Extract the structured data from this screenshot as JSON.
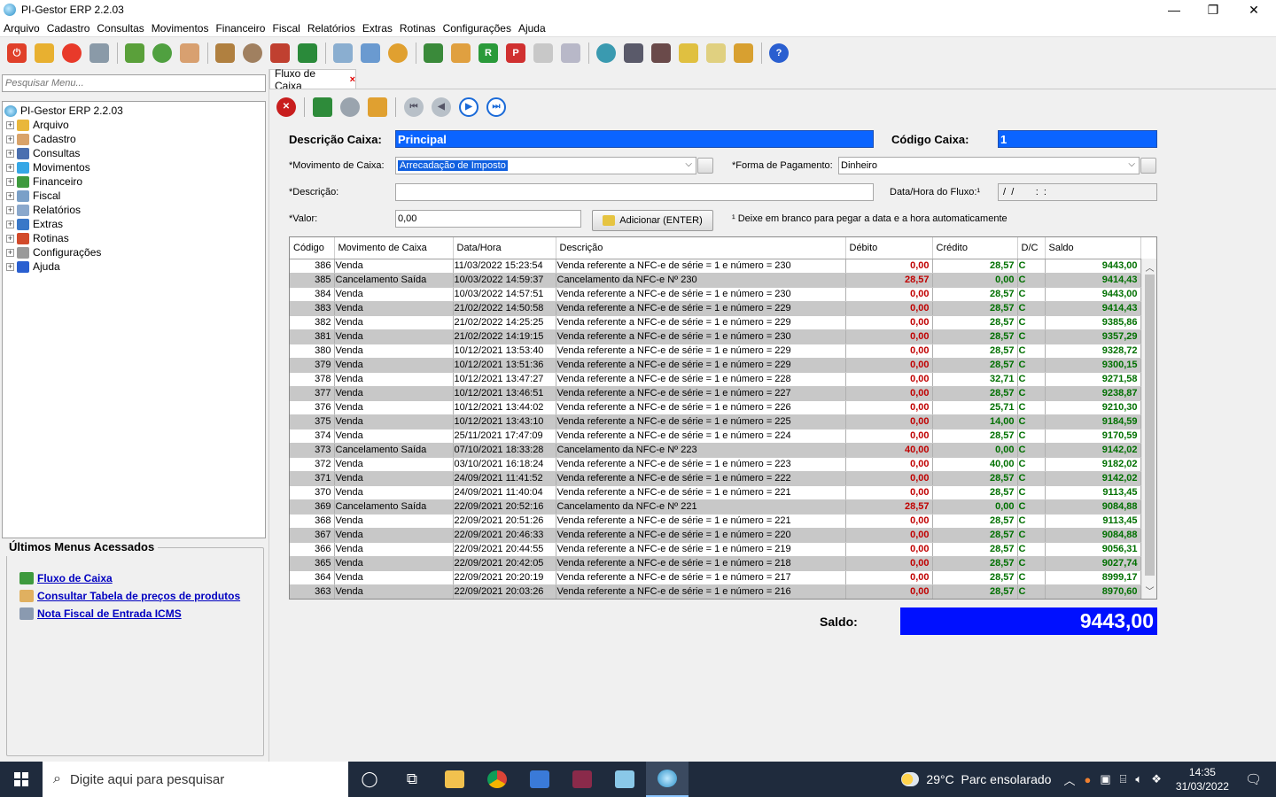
{
  "window": {
    "title": "PI-Gestor ERP 2.2.03",
    "minimize": "—",
    "maximize": "❐",
    "close": "✕"
  },
  "menubar": [
    "Arquivo",
    "Cadastro",
    "Consultas",
    "Movimentos",
    "Financeiro",
    "Fiscal",
    "Relatórios",
    "Extras",
    "Rotinas",
    "Configurações",
    "Ajuda"
  ],
  "left": {
    "search_placeholder": "Pesquisar Menu...",
    "tree_root": "PI-Gestor ERP 2.2.03",
    "tree_items": [
      {
        "label": "Arquivo",
        "color": "#e9b73b"
      },
      {
        "label": "Cadastro",
        "color": "#d9a36a"
      },
      {
        "label": "Consultas",
        "color": "#4a6fb0"
      },
      {
        "label": "Movimentos",
        "color": "#35a7e6"
      },
      {
        "label": "Financeiro",
        "color": "#3e9a3e"
      },
      {
        "label": "Fiscal",
        "color": "#7aa0c8"
      },
      {
        "label": "Relatórios",
        "color": "#8aa8cc"
      },
      {
        "label": "Extras",
        "color": "#3a78c8"
      },
      {
        "label": "Rotinas",
        "color": "#d24a2a"
      },
      {
        "label": "Configurações",
        "color": "#9a9a9a"
      },
      {
        "label": "Ajuda",
        "color": "#2a5fd0"
      }
    ],
    "recent_title": "Últimos Menus Acessados",
    "recent": [
      {
        "label": "Fluxo de Caixa",
        "color": "#3e9a3e"
      },
      {
        "label": "Consultar Tabela de preços de produtos",
        "color": "#e0b060"
      },
      {
        "label": "Nota Fiscal de Entrada ICMS",
        "color": "#8a9ab0"
      }
    ]
  },
  "tab": {
    "label": "Fluxo de Caixa",
    "close": "×"
  },
  "form": {
    "descricao_caixa_label": "Descrição Caixa:",
    "descricao_caixa_value": "Principal",
    "codigo_caixa_label": "Código Caixa:",
    "codigo_caixa_value": "1",
    "movimento_label": "*Movimento de Caixa:",
    "movimento_value": "Arrecadação de Imposto",
    "forma_label": "*Forma de Pagamento:",
    "forma_value": "Dinheiro",
    "descricao_label": "*Descrição:",
    "descricao_value": "",
    "datahora_label": "Data/Hora do Fluxo:¹",
    "datahora_value": " /  /        :  :",
    "valor_label": "*Valor:",
    "valor_value": "0,00",
    "add_button": "Adicionar (ENTER)",
    "note": "¹ Deixe em branco para pegar a data e a hora automaticamente"
  },
  "grid": {
    "columns": [
      "Código",
      "Movimento de Caixa",
      "Data/Hora",
      "Descrição",
      "Débito",
      "Crédito",
      "D/C",
      "Saldo"
    ],
    "rows": [
      [
        "386",
        "Venda",
        "11/03/2022 15:23:54",
        "Venda referente a NFC-e de série = 1 e número = 230",
        "0,00",
        "28,57",
        "C",
        "9443,00"
      ],
      [
        "385",
        "Cancelamento Saída",
        "10/03/2022 14:59:37",
        "Cancelamento da NFC-e Nº 230",
        "28,57",
        "0,00",
        "C",
        "9414,43"
      ],
      [
        "384",
        "Venda",
        "10/03/2022 14:57:51",
        "Venda referente a NFC-e de série = 1 e número = 230",
        "0,00",
        "28,57",
        "C",
        "9443,00"
      ],
      [
        "383",
        "Venda",
        "21/02/2022 14:50:58",
        "Venda referente a NFC-e de série = 1 e número = 229",
        "0,00",
        "28,57",
        "C",
        "9414,43"
      ],
      [
        "382",
        "Venda",
        "21/02/2022 14:25:25",
        "Venda referente a NFC-e de série = 1 e número = 229",
        "0,00",
        "28,57",
        "C",
        "9385,86"
      ],
      [
        "381",
        "Venda",
        "21/02/2022 14:19:15",
        "Venda referente a NFC-e de série = 1 e número = 230",
        "0,00",
        "28,57",
        "C",
        "9357,29"
      ],
      [
        "380",
        "Venda",
        "10/12/2021 13:53:40",
        "Venda referente a NFC-e de série = 1 e número = 229",
        "0,00",
        "28,57",
        "C",
        "9328,72"
      ],
      [
        "379",
        "Venda",
        "10/12/2021 13:51:36",
        "Venda referente a NFC-e de série = 1 e número = 229",
        "0,00",
        "28,57",
        "C",
        "9300,15"
      ],
      [
        "378",
        "Venda",
        "10/12/2021 13:47:27",
        "Venda referente a NFC-e de série = 1 e número = 228",
        "0,00",
        "32,71",
        "C",
        "9271,58"
      ],
      [
        "377",
        "Venda",
        "10/12/2021 13:46:51",
        "Venda referente a NFC-e de série = 1 e número = 227",
        "0,00",
        "28,57",
        "C",
        "9238,87"
      ],
      [
        "376",
        "Venda",
        "10/12/2021 13:44:02",
        "Venda referente a NFC-e de série = 1 e número = 226",
        "0,00",
        "25,71",
        "C",
        "9210,30"
      ],
      [
        "375",
        "Venda",
        "10/12/2021 13:43:10",
        "Venda referente a NFC-e de série = 1 e número = 225",
        "0,00",
        "14,00",
        "C",
        "9184,59"
      ],
      [
        "374",
        "Venda",
        "25/11/2021 17:47:09",
        "Venda referente a NFC-e de série = 1 e número = 224",
        "0,00",
        "28,57",
        "C",
        "9170,59"
      ],
      [
        "373",
        "Cancelamento Saída",
        "07/10/2021 18:33:28",
        "Cancelamento da NFC-e Nº 223",
        "40,00",
        "0,00",
        "C",
        "9142,02"
      ],
      [
        "372",
        "Venda",
        "03/10/2021 16:18:24",
        "Venda referente a NFC-e de série = 1 e número = 223",
        "0,00",
        "40,00",
        "C",
        "9182,02"
      ],
      [
        "371",
        "Venda",
        "24/09/2021 11:41:52",
        "Venda referente a NFC-e de série = 1 e número = 222",
        "0,00",
        "28,57",
        "C",
        "9142,02"
      ],
      [
        "370",
        "Venda",
        "24/09/2021 11:40:04",
        "Venda referente a NFC-e de série = 1 e número = 221",
        "0,00",
        "28,57",
        "C",
        "9113,45"
      ],
      [
        "369",
        "Cancelamento Saída",
        "22/09/2021 20:52:16",
        "Cancelamento da NFC-e Nº 221",
        "28,57",
        "0,00",
        "C",
        "9084,88"
      ],
      [
        "368",
        "Venda",
        "22/09/2021 20:51:26",
        "Venda referente a NFC-e de série = 1 e número = 221",
        "0,00",
        "28,57",
        "C",
        "9113,45"
      ],
      [
        "367",
        "Venda",
        "22/09/2021 20:46:33",
        "Venda referente a NFC-e de série = 1 e número = 220",
        "0,00",
        "28,57",
        "C",
        "9084,88"
      ],
      [
        "366",
        "Venda",
        "22/09/2021 20:44:55",
        "Venda referente a NFC-e de série = 1 e número = 219",
        "0,00",
        "28,57",
        "C",
        "9056,31"
      ],
      [
        "365",
        "Venda",
        "22/09/2021 20:42:05",
        "Venda referente a NFC-e de série = 1 e número = 218",
        "0,00",
        "28,57",
        "C",
        "9027,74"
      ],
      [
        "364",
        "Venda",
        "22/09/2021 20:20:19",
        "Venda referente a NFC-e de série = 1 e número = 217",
        "0,00",
        "28,57",
        "C",
        "8999,17"
      ],
      [
        "363",
        "Venda",
        "22/09/2021 20:03:26",
        "Venda referente a NFC-e de série = 1 e número = 216",
        "0,00",
        "28,57",
        "C",
        "8970,60"
      ]
    ]
  },
  "saldo": {
    "label": "Saldo:",
    "value": "9443,00"
  },
  "taskbar": {
    "search_placeholder": "Digite aqui para pesquisar",
    "weather": "29°C  Parc ensolarado",
    "time": "14:35",
    "date": "31/03/2022"
  },
  "colors": {
    "accent_blue": "#0a64ff",
    "saldo_blue": "#0010ff",
    "credit_green": "#007000",
    "debit_red": "#c00000"
  }
}
